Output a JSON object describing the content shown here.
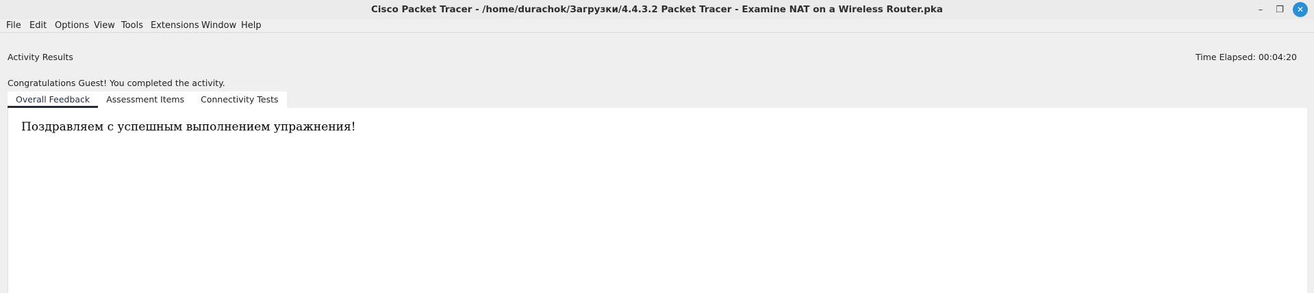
{
  "window": {
    "title": "Cisco Packet Tracer - /home/durachok/Загрузки/4.4.3.2 Packet Tracer - Examine NAT on a Wireless Router.pka",
    "minimize_glyph": "–",
    "maximize_glyph": "❐",
    "close_glyph": "✕"
  },
  "menu": [
    {
      "label": "File"
    },
    {
      "label": "Edit"
    },
    {
      "label": "Options"
    },
    {
      "label": "View"
    },
    {
      "label": "Tools"
    },
    {
      "label": "Extensions"
    },
    {
      "label": "Window"
    },
    {
      "label": "Help"
    }
  ],
  "results": {
    "heading": "Activity Results",
    "time_elapsed": "Time Elapsed: 00:04:20",
    "congrats": "Congratulations Guest! You completed the activity."
  },
  "tabs": [
    {
      "label": "Overall Feedback",
      "active": true
    },
    {
      "label": "Assessment Items",
      "active": false
    },
    {
      "label": "Connectivity Tests",
      "active": false
    }
  ],
  "feedback": {
    "message": "Поздравляем с успешным выполнением упражнения!"
  },
  "colors": {
    "accent": "#1e2b45",
    "close_button": "#2a8fd4"
  }
}
